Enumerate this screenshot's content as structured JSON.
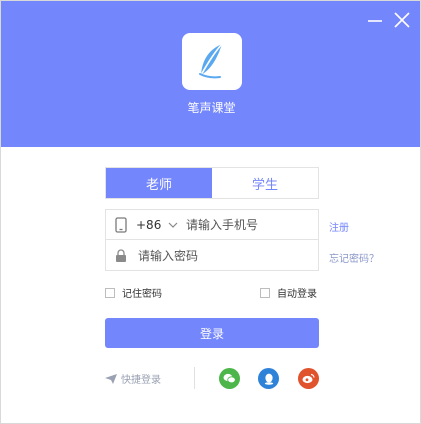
{
  "app": {
    "name": "笔声课堂"
  },
  "colors": {
    "brand": "#7486fc",
    "wechat": "#4cb64a",
    "qq": "#2e83d8",
    "weibo": "#e0532d"
  },
  "window_controls": {
    "minimize_icon": "minimize-icon",
    "close_icon": "close-icon"
  },
  "tabs": [
    {
      "label": "老师",
      "active": true
    },
    {
      "label": "学生",
      "active": false
    }
  ],
  "form": {
    "phone": {
      "icon": "phone-icon",
      "country_code": "+86",
      "placeholder": "请输入手机号",
      "value": ""
    },
    "password": {
      "icon": "lock-icon",
      "placeholder": "请输入密码",
      "value": ""
    }
  },
  "links": {
    "register": "注册",
    "forgot_password": "忘记密码？"
  },
  "options": {
    "remember_password": "记住密码",
    "auto_login": "自动登录"
  },
  "login_button": "登录",
  "quick_login": {
    "icon": "paper-plane-icon",
    "label": "快捷登录"
  },
  "social": [
    "wechat-icon",
    "qq-icon",
    "weibo-icon"
  ]
}
